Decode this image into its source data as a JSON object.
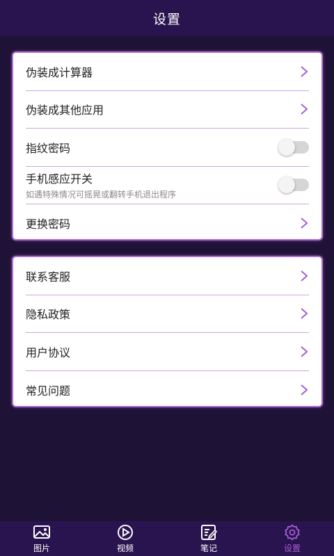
{
  "header": {
    "title": "设置"
  },
  "colors": {
    "accent": "#a45fd1",
    "header_bg": "#2a1450",
    "page_bg": "#1e1336"
  },
  "card1": {
    "items": [
      {
        "label": "伪装成计算器",
        "control": "chevron"
      },
      {
        "label": "伪装成其他应用",
        "control": "chevron"
      },
      {
        "label": "指纹密码",
        "control": "toggle",
        "on": false
      },
      {
        "label": "手机感应开关",
        "sub": "如遇特殊情况可摇晃或翻转手机退出程序",
        "control": "toggle",
        "on": false
      },
      {
        "label": "更换密码",
        "control": "chevron"
      }
    ]
  },
  "card2": {
    "items": [
      {
        "label": "联系客服",
        "control": "chevron"
      },
      {
        "label": "隐私政策",
        "control": "chevron"
      },
      {
        "label": "用户协议",
        "control": "chevron"
      },
      {
        "label": "常见问题",
        "control": "chevron"
      }
    ]
  },
  "tabbar": {
    "tabs": [
      {
        "label": "图片",
        "icon": "image-icon",
        "active": false
      },
      {
        "label": "视频",
        "icon": "play-icon",
        "active": false
      },
      {
        "label": "笔记",
        "icon": "note-icon",
        "active": false
      },
      {
        "label": "设置",
        "icon": "gear-icon",
        "active": true
      }
    ]
  }
}
